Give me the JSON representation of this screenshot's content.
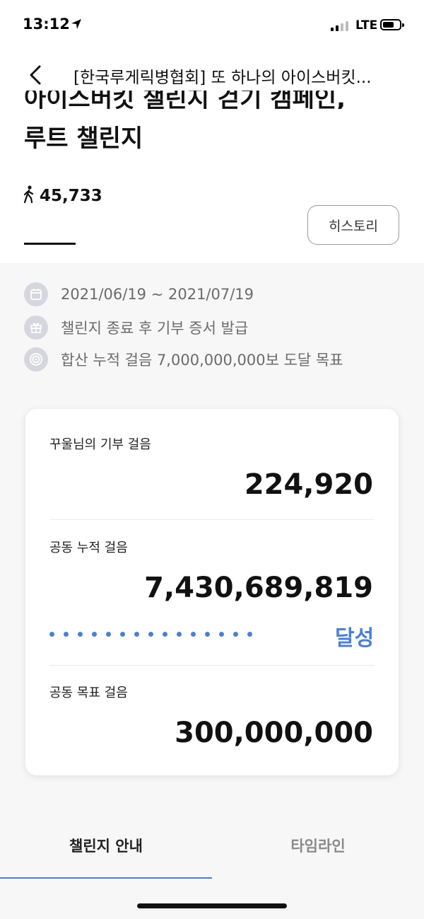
{
  "status_bar": {
    "time": "13:12",
    "network": "LTE"
  },
  "header": {
    "title": "[한국루게릭병협회] 또 하나의 아이스버킷..."
  },
  "challenge": {
    "title_line1": "아이스버킷 챌린지 걷기 캠페인,",
    "title_line2": "루트 챌린지",
    "step_count": "45,733",
    "history_button": "히스토리"
  },
  "info": {
    "period": "2021/06/19 ~ 2021/07/19",
    "certificate": "챌린지 종료 후 기부 증서 발급",
    "goal_text": "합산 누적 걸음 7,000,000,000보 도달 목표"
  },
  "stats": {
    "my_steps_label": "꾸울님의 기부 걸음",
    "my_steps_value": "224,920",
    "total_steps_label": "공동 누적 걸음",
    "total_steps_value": "7,430,689,819",
    "achieved_label": "달성",
    "goal_steps_label": "공동 목표 걸음",
    "goal_steps_value": "300,000,000"
  },
  "tabs": {
    "guide": "챌린지 안내",
    "timeline": "타임라인"
  },
  "colors": {
    "accent": "#4a80d6",
    "section_bg": "#f7f7f8"
  },
  "icons": [
    "location-arrow-icon",
    "signal-icon",
    "battery-icon",
    "back-chevron-icon",
    "walking-person-icon",
    "calendar-icon",
    "gift-icon",
    "target-icon"
  ]
}
